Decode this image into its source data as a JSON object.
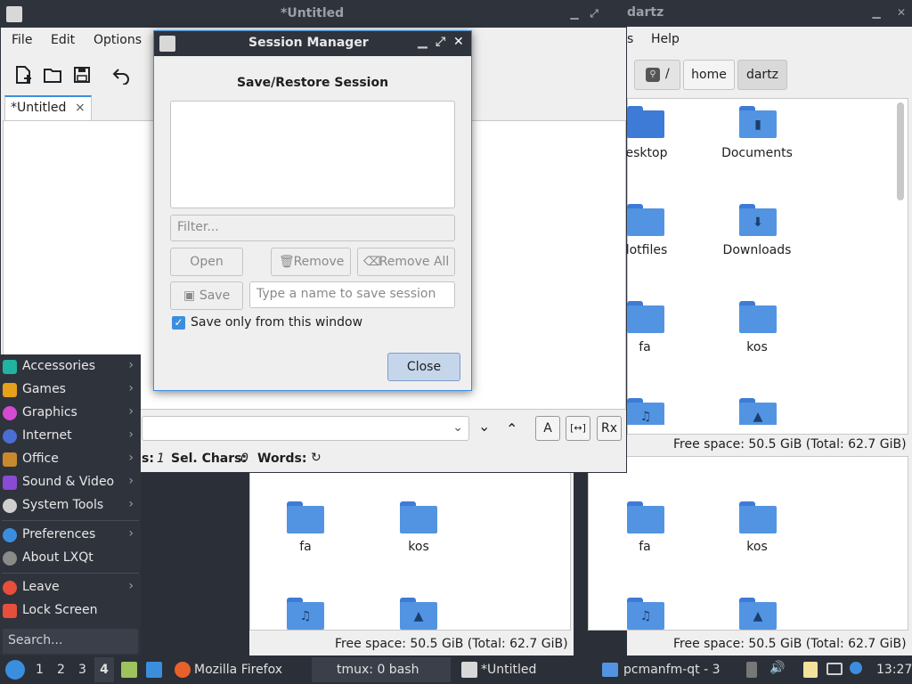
{
  "featherpad": {
    "title": "*Untitled",
    "menu": [
      "File",
      "Edit",
      "Options"
    ],
    "tab_label": "*Untitled",
    "status": {
      "lines_suffix": "s:",
      "lines_value": "1",
      "sel_label": "Sel. Chars:",
      "sel_value": "0",
      "words_label": "Words:"
    }
  },
  "filemanager": {
    "title_fragment": "dartz",
    "menu_fragment": "s",
    "help": "Help",
    "path": [
      "/",
      "home",
      "dartz"
    ],
    "top_items": [
      {
        "name": "Desktop",
        "visible": "esktop",
        "glyph": ""
      },
      {
        "name": "Documents",
        "visible": "Documents",
        "glyph": "▮"
      },
      {
        "name": "dotfiles",
        "visible": "lotfiles",
        "glyph": ""
      },
      {
        "name": "Downloads",
        "visible": "Downloads",
        "glyph": "⬇"
      },
      {
        "name": "fa",
        "visible": "fa",
        "glyph": ""
      },
      {
        "name": "kos",
        "visible": "kos",
        "glyph": ""
      }
    ],
    "free_space": "Free space: 50.5 GiB (Total: 62.7 GiB)",
    "pane_items": [
      "fa",
      "kos"
    ]
  },
  "session_manager": {
    "title": "Session Manager",
    "heading": "Save/Restore Session",
    "filter_placeholder": "Filter...",
    "open": "Open",
    "remove": "Remove",
    "remove_all": "Remove All",
    "save": "Save",
    "name_placeholder": "Type a name to save session",
    "checkbox_label": "Save only from this window",
    "checkbox_checked": true,
    "close": "Close"
  },
  "start_menu": {
    "items": [
      {
        "label": "Accessories",
        "color": "#1fb3a0"
      },
      {
        "label": "Games",
        "color": "#e6a019"
      },
      {
        "label": "Graphics",
        "color": "#d44ad1"
      },
      {
        "label": "Internet",
        "color": "#4a6fd4"
      },
      {
        "label": "Office",
        "color": "#c8892e"
      },
      {
        "label": "Sound & Video",
        "color": "#8a4ad4"
      },
      {
        "label": "System Tools",
        "color": "#cfcfcf"
      }
    ],
    "items2": [
      {
        "label": "Preferences",
        "color": "#3b8ede"
      },
      {
        "label": "About LXQt",
        "color": "#8a8a8a"
      }
    ],
    "items3": [
      {
        "label": "Leave",
        "color": "#e84e3c"
      },
      {
        "label": "Lock Screen",
        "color": "#e84e3c"
      }
    ],
    "search_placeholder": "Search..."
  },
  "panel": {
    "desktops": [
      "1",
      "2",
      "3",
      "4"
    ],
    "tasks": [
      "Mozilla Firefox",
      "tmux: 0 bash",
      "*Untitled",
      "pcmanfm-qt - 3 ..."
    ],
    "clock": "13:27"
  }
}
